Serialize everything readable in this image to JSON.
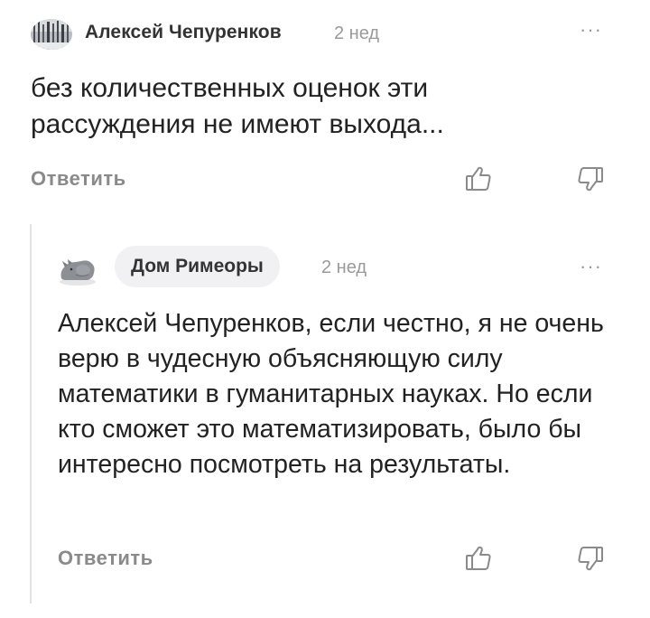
{
  "comment": {
    "author": "Алексей Чепуренков",
    "time": "2 нед",
    "more": "···",
    "text": "без количественных оценок эти рассуждения не имеют выхода...",
    "reply_label": "Ответить",
    "like_icon": "thumbs-up-icon",
    "dislike_icon": "thumbs-down-icon"
  },
  "reply": {
    "author": "Дом Римеоры",
    "time": "2 нед",
    "more": "···",
    "text": "Алексей Чепуренков, если честно, я не очень верю в чудесную объясняющую силу математики в гуманитарных науках. Но если кто сможет это математизировать, было бы интересно посмотреть на результаты.",
    "reply_label": "Ответить",
    "like_icon": "thumbs-up-icon",
    "dislike_icon": "thumbs-down-icon"
  },
  "colors": {
    "muted": "#9a9a9a",
    "action": "#8a8a8a",
    "pill": "#f1f1f3",
    "thread_line": "#e3e3e3"
  }
}
